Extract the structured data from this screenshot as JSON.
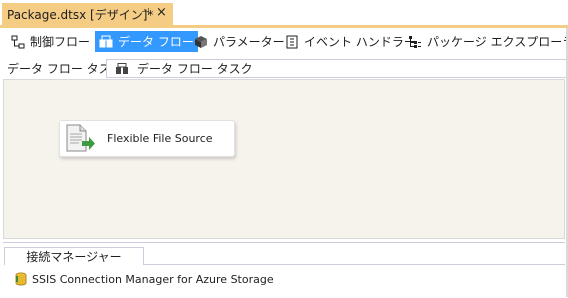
{
  "document_tab": {
    "title": "Package.dtsx [デザイン]*",
    "pin_glyph": "⊣",
    "close_glyph": "×"
  },
  "designer_tabs": [
    {
      "label": "制御フロー",
      "icon": "control-flow-icon",
      "active": false
    },
    {
      "label": "データ フロー",
      "icon": "data-flow-icon",
      "active": true
    },
    {
      "label": "パラメーター",
      "icon": "parameters-icon",
      "active": false
    },
    {
      "label": "イベント ハンドラー",
      "icon": "event-handler-icon",
      "active": false
    },
    {
      "label": "パッケージ エクスプローラー",
      "icon": "package-explorer-icon",
      "active": false
    }
  ],
  "task_selector": {
    "label": "データ フロー タスク:",
    "selected": "データ フロー タスク",
    "icon": "data-flow-task-icon"
  },
  "design_surface": {
    "components": [
      {
        "label": "Flexible File Source",
        "icon": "flexible-file-source-icon"
      }
    ]
  },
  "connection_managers": {
    "tab_label": "接続マネージャー",
    "items": [
      {
        "label": "SSIS Connection Manager for Azure Storage",
        "icon": "azure-storage-connection-icon"
      }
    ]
  },
  "colors": {
    "tab_accent": "#f5cc84",
    "active_tab": "#3399ff",
    "surface": "#f5f3eb"
  }
}
